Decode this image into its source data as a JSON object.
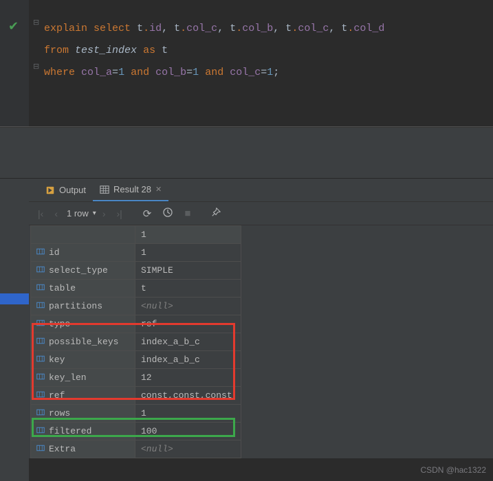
{
  "editor": {
    "line1": {
      "kw1": "explain",
      "kw2": "select",
      "alias": "t",
      "id": "id",
      "c1": "col_c",
      "c2": "col_b",
      "c3": "col_c",
      "c4": "col_d"
    },
    "line2": {
      "kw1": "from",
      "table": "test_index",
      "kw2": "as",
      "alias": "t"
    },
    "line3": {
      "kw1": "where",
      "ca": "col_a",
      "cb": "col_b",
      "cc": "col_c",
      "kwand": "and",
      "eq": "=",
      "v": "1",
      "semi": ";"
    }
  },
  "tabs": {
    "output": "Output",
    "result": "Result 28"
  },
  "toolbar": {
    "row_count": "1 row"
  },
  "grid": {
    "col_header": "1",
    "rows": [
      {
        "k": "id",
        "v": "1"
      },
      {
        "k": "select_type",
        "v": "SIMPLE"
      },
      {
        "k": "table",
        "v": "t"
      },
      {
        "k": "partitions",
        "v": "<null>",
        "null": true
      },
      {
        "k": "type",
        "v": "ref"
      },
      {
        "k": "possible_keys",
        "v": "index_a_b_c"
      },
      {
        "k": "key",
        "v": "index_a_b_c"
      },
      {
        "k": "key_len",
        "v": "12"
      },
      {
        "k": "ref",
        "v": "const,const,const"
      },
      {
        "k": "rows",
        "v": "1"
      },
      {
        "k": "filtered",
        "v": "100"
      },
      {
        "k": "Extra",
        "v": "<null>",
        "null": true
      }
    ]
  },
  "watermark": "CSDN @hac1322"
}
